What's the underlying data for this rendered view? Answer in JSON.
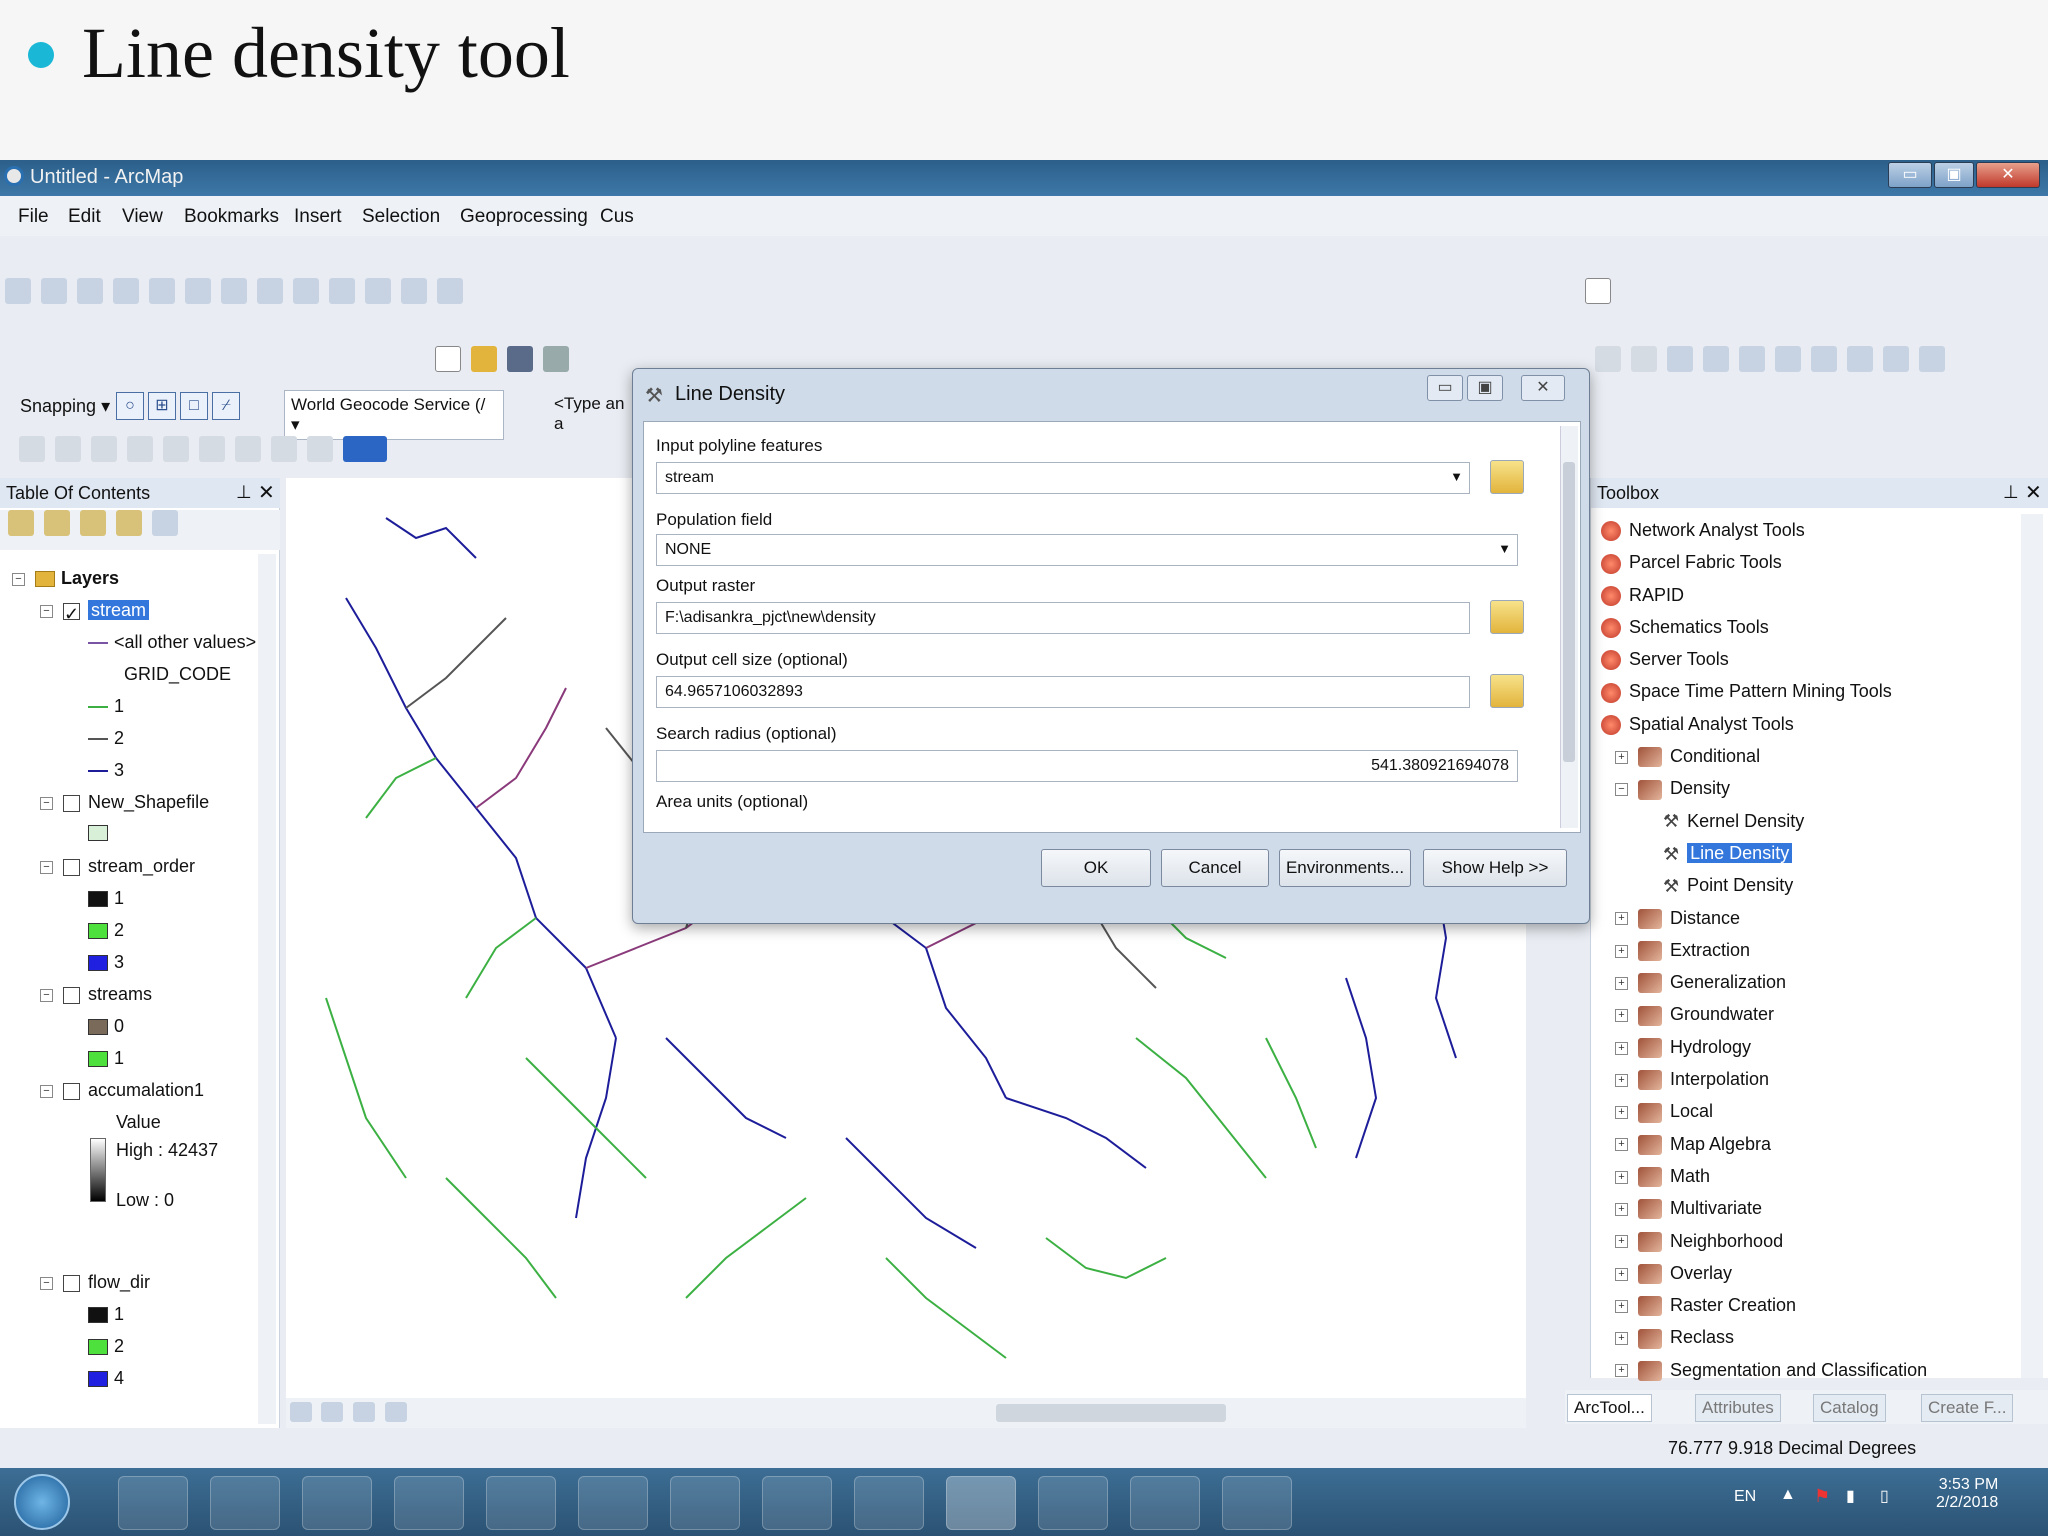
{
  "slide": {
    "title": "Line density tool"
  },
  "window": {
    "title": "Untitled - ArcMap",
    "min": "▭",
    "max": "▣",
    "close": "✕"
  },
  "menu": [
    "File",
    "Edit",
    "View",
    "Bookmarks",
    "Insert",
    "Selection",
    "Geoprocessing",
    "Cus"
  ],
  "snapping": {
    "label": "Snapping ▾",
    "geocoder": "World Geocode Service (/ ▾",
    "search_placeholder": "<Type an a"
  },
  "toc": {
    "title": "Table Of Contents",
    "root": "Layers",
    "layers": [
      {
        "name": "stream",
        "checked": true,
        "selected": true
      },
      {
        "name": "<all other values>"
      },
      {
        "name": "GRID_CODE"
      },
      {
        "name": "1"
      },
      {
        "name": "2"
      },
      {
        "name": "3"
      },
      {
        "name": "New_Shapefile",
        "checked": false
      },
      {
        "name": "stream_order",
        "checked": false
      },
      {
        "name": "1"
      },
      {
        "name": "2"
      },
      {
        "name": "3"
      },
      {
        "name": "streams",
        "checked": false
      },
      {
        "name": "0"
      },
      {
        "name": "1"
      },
      {
        "name": "accumalation1",
        "checked": false
      },
      {
        "name": "Value"
      },
      {
        "name": "High : 42437"
      },
      {
        "name": "Low : 0"
      },
      {
        "name": "flow_dir",
        "checked": false
      },
      {
        "name": "1"
      },
      {
        "name": "2"
      },
      {
        "name": "4"
      }
    ]
  },
  "dialog": {
    "title": "Line Density",
    "fields": {
      "input_label": "Input polyline features",
      "input_value": "stream",
      "population_label": "Population field",
      "population_value": "NONE",
      "output_label": "Output raster",
      "output_value": "F:\\adisankra_pjct\\new\\density",
      "cellsize_label": "Output cell size (optional)",
      "cellsize_value": "64.9657106032893",
      "radius_label": "Search radius (optional)",
      "radius_value": "541.380921694078",
      "area_label": "Area units (optional)"
    },
    "buttons": {
      "ok": "OK",
      "cancel": "Cancel",
      "env": "Environments...",
      "help": "Show Help >>"
    }
  },
  "toolbox": {
    "title": "Toolbox",
    "items": [
      {
        "label": "Network Analyst Tools",
        "kind": "toolbox"
      },
      {
        "label": "Parcel Fabric Tools",
        "kind": "toolbox"
      },
      {
        "label": "RAPID",
        "kind": "toolbox"
      },
      {
        "label": "Schematics Tools",
        "kind": "toolbox"
      },
      {
        "label": "Server Tools",
        "kind": "toolbox"
      },
      {
        "label": "Space Time Pattern Mining Tools",
        "kind": "toolbox"
      },
      {
        "label": "Spatial Analyst Tools",
        "kind": "toolbox"
      },
      {
        "label": "Conditional",
        "kind": "set"
      },
      {
        "label": "Density",
        "kind": "set-open"
      },
      {
        "label": "Kernel Density",
        "kind": "tool"
      },
      {
        "label": "Line Density",
        "kind": "tool",
        "selected": true
      },
      {
        "label": "Point Density",
        "kind": "tool"
      },
      {
        "label": "Distance",
        "kind": "set"
      },
      {
        "label": "Extraction",
        "kind": "set"
      },
      {
        "label": "Generalization",
        "kind": "set"
      },
      {
        "label": "Groundwater",
        "kind": "set"
      },
      {
        "label": "Hydrology",
        "kind": "set"
      },
      {
        "label": "Interpolation",
        "kind": "set"
      },
      {
        "label": "Local",
        "kind": "set"
      },
      {
        "label": "Map Algebra",
        "kind": "set"
      },
      {
        "label": "Math",
        "kind": "set"
      },
      {
        "label": "Multivariate",
        "kind": "set"
      },
      {
        "label": "Neighborhood",
        "kind": "set"
      },
      {
        "label": "Overlay",
        "kind": "set"
      },
      {
        "label": "Raster Creation",
        "kind": "set"
      },
      {
        "label": "Reclass",
        "kind": "set"
      },
      {
        "label": "Segmentation and Classification",
        "kind": "set"
      }
    ],
    "tabs": [
      "ArcTool...",
      "Attributes",
      "Catalog",
      "Create F..."
    ]
  },
  "status": {
    "coords": "76.777  9.918 Decimal Degrees"
  },
  "taskbar": {
    "lang": "EN",
    "time": "3:53 PM",
    "date": "2/2/2018"
  },
  "colors": {
    "accent": "#3377dd",
    "bullet": "#1ab7d6",
    "stream_1": "#3cb043",
    "stream_2": "#555555",
    "stream_3": "#1d1d9a"
  }
}
